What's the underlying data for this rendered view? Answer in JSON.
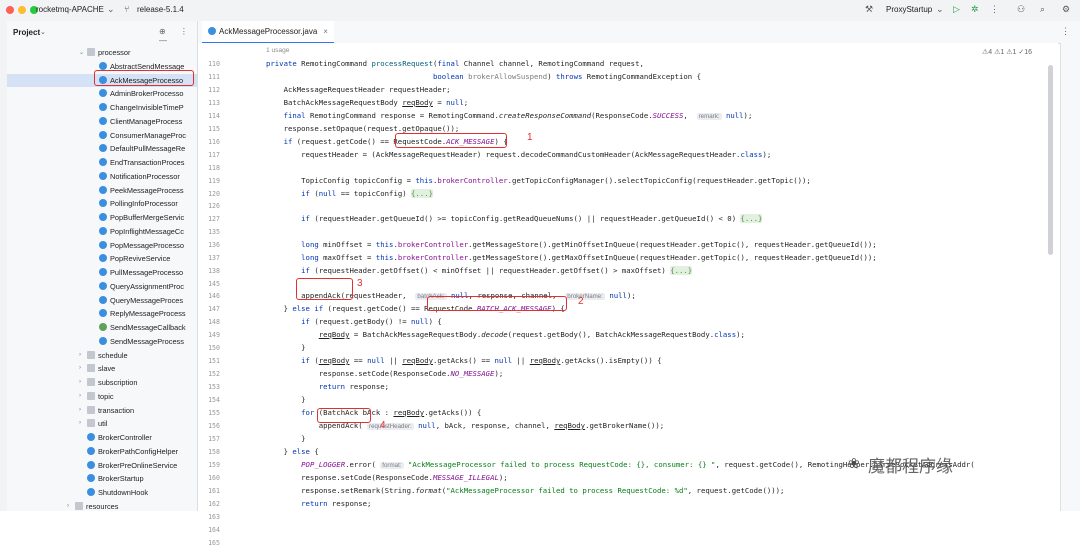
{
  "titlebar": {
    "project": "rocketmq-APACHE",
    "branch": "release-5.1.4",
    "run_config": "ProxyStartup"
  },
  "project_panel": {
    "title": "Project",
    "tree": [
      {
        "label": "processor",
        "kind": "folder",
        "expanded": true
      },
      {
        "label": "AbstractSendMessage",
        "kind": "class"
      },
      {
        "label": "AckMessageProcesso",
        "kind": "class",
        "selected": true
      },
      {
        "label": "AdminBrokerProcesso",
        "kind": "class"
      },
      {
        "label": "ChangeInvisibleTimeP",
        "kind": "class"
      },
      {
        "label": "ClientManageProcess",
        "kind": "class"
      },
      {
        "label": "ConsumerManageProc",
        "kind": "class"
      },
      {
        "label": "DefaultPullMessageRe",
        "kind": "class"
      },
      {
        "label": "EndTransactionProces",
        "kind": "class"
      },
      {
        "label": "NotificationProcessor",
        "kind": "class"
      },
      {
        "label": "PeekMessageProcess",
        "kind": "class"
      },
      {
        "label": "PollingInfoProcessor",
        "kind": "class"
      },
      {
        "label": "PopBufferMergeServic",
        "kind": "class"
      },
      {
        "label": "PopInflightMessageCc",
        "kind": "class"
      },
      {
        "label": "PopMessageProcesso",
        "kind": "class"
      },
      {
        "label": "PopReviveService",
        "kind": "class"
      },
      {
        "label": "PullMessageProcesso",
        "kind": "class"
      },
      {
        "label": "QueryAssignmentProc",
        "kind": "class"
      },
      {
        "label": "QueryMessageProces",
        "kind": "class"
      },
      {
        "label": "ReplyMessageProcess",
        "kind": "class"
      },
      {
        "label": "SendMessageCallback",
        "kind": "interface"
      },
      {
        "label": "SendMessageProcess",
        "kind": "class"
      },
      {
        "label": "schedule",
        "kind": "folder"
      },
      {
        "label": "slave",
        "kind": "folder"
      },
      {
        "label": "subscription",
        "kind": "folder"
      },
      {
        "label": "topic",
        "kind": "folder"
      },
      {
        "label": "transaction",
        "kind": "folder"
      },
      {
        "label": "util",
        "kind": "folder"
      },
      {
        "label": "BrokerController",
        "kind": "class"
      },
      {
        "label": "BrokerPathConfigHelper",
        "kind": "class"
      },
      {
        "label": "BrokerPreOnlineService",
        "kind": "class"
      },
      {
        "label": "BrokerStartup",
        "kind": "class"
      },
      {
        "label": "ShutdownHook",
        "kind": "class"
      },
      {
        "label": "resources",
        "kind": "folder"
      }
    ]
  },
  "editor": {
    "tab_label": "AckMessageProcessor.java",
    "usages": "1 usage",
    "inspections": "⚠4 ⚠1 ⚠1 ✓16",
    "line_numbers": [
      "110",
      "111",
      "112",
      "113",
      "114",
      "115",
      "116",
      "117",
      "118",
      "119",
      "120",
      "126",
      "127",
      "135",
      "136",
      "137",
      "138",
      "145",
      "146",
      "147",
      "148",
      "149",
      "150",
      "151",
      "152",
      "153",
      "154",
      "155",
      "156",
      "157",
      "158",
      "159",
      "160",
      "161",
      "162",
      "163",
      "164",
      "165"
    ],
    "annotations": [
      "1",
      "2",
      "3",
      "4"
    ]
  },
  "watermark": "魔都程序缘"
}
